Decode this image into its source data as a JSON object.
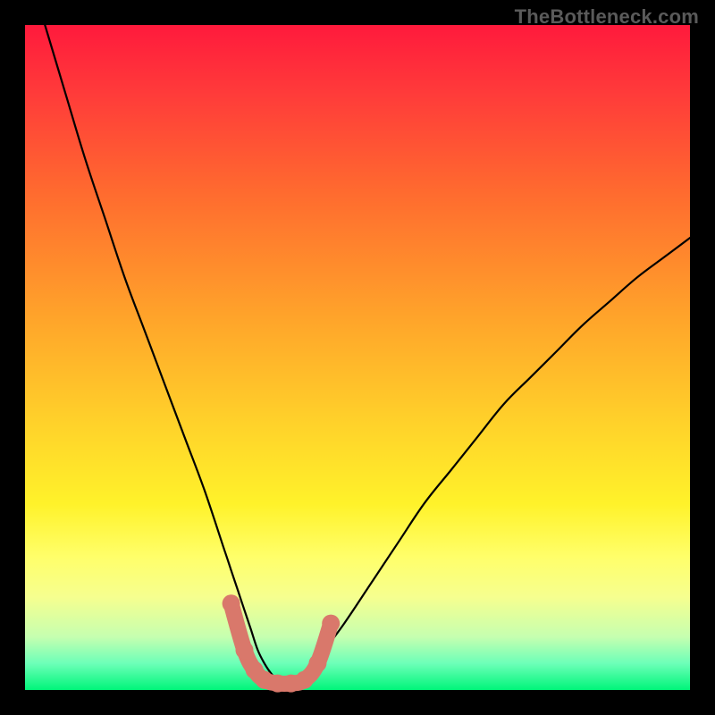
{
  "watermark": "TheBottleneck.com",
  "chart_data": {
    "type": "line",
    "title": "",
    "xlabel": "",
    "ylabel": "",
    "xlim": [
      0,
      100
    ],
    "ylim": [
      0,
      100
    ],
    "grid": false,
    "legend": false,
    "series": [
      {
        "name": "bottleneck-curve",
        "color": "#000000",
        "x": [
          3,
          6,
          9,
          12,
          15,
          18,
          21,
          24,
          27,
          30,
          31,
          32,
          33,
          34,
          35,
          36,
          37,
          38,
          39,
          40,
          41,
          42,
          43,
          45,
          48,
          52,
          56,
          60,
          64,
          68,
          72,
          76,
          80,
          84,
          88,
          92,
          96,
          100
        ],
        "y": [
          100,
          90,
          80,
          71,
          62,
          54,
          46,
          38,
          30,
          21,
          18,
          15,
          12,
          9,
          6,
          4,
          2.5,
          1.5,
          1,
          1,
          1.2,
          2,
          3.5,
          6,
          10,
          16,
          22,
          28,
          33,
          38,
          43,
          47,
          51,
          55,
          58.5,
          62,
          65,
          68
        ]
      },
      {
        "name": "optimal-zone-band",
        "type": "scatter",
        "color": "#d9786b",
        "x": [
          31,
          33,
          34.5,
          36,
          38,
          40,
          42,
          44,
          46
        ],
        "y": [
          13,
          6,
          3,
          1.5,
          1,
          1,
          1.5,
          4,
          10
        ]
      }
    ],
    "annotations": []
  },
  "colors": {
    "frame": "#000000",
    "curve": "#000000",
    "band": "#d9786b",
    "gradient_top": "#ff1a3c",
    "gradient_bottom": "#00f57a",
    "watermark": "#5a5a5a"
  }
}
